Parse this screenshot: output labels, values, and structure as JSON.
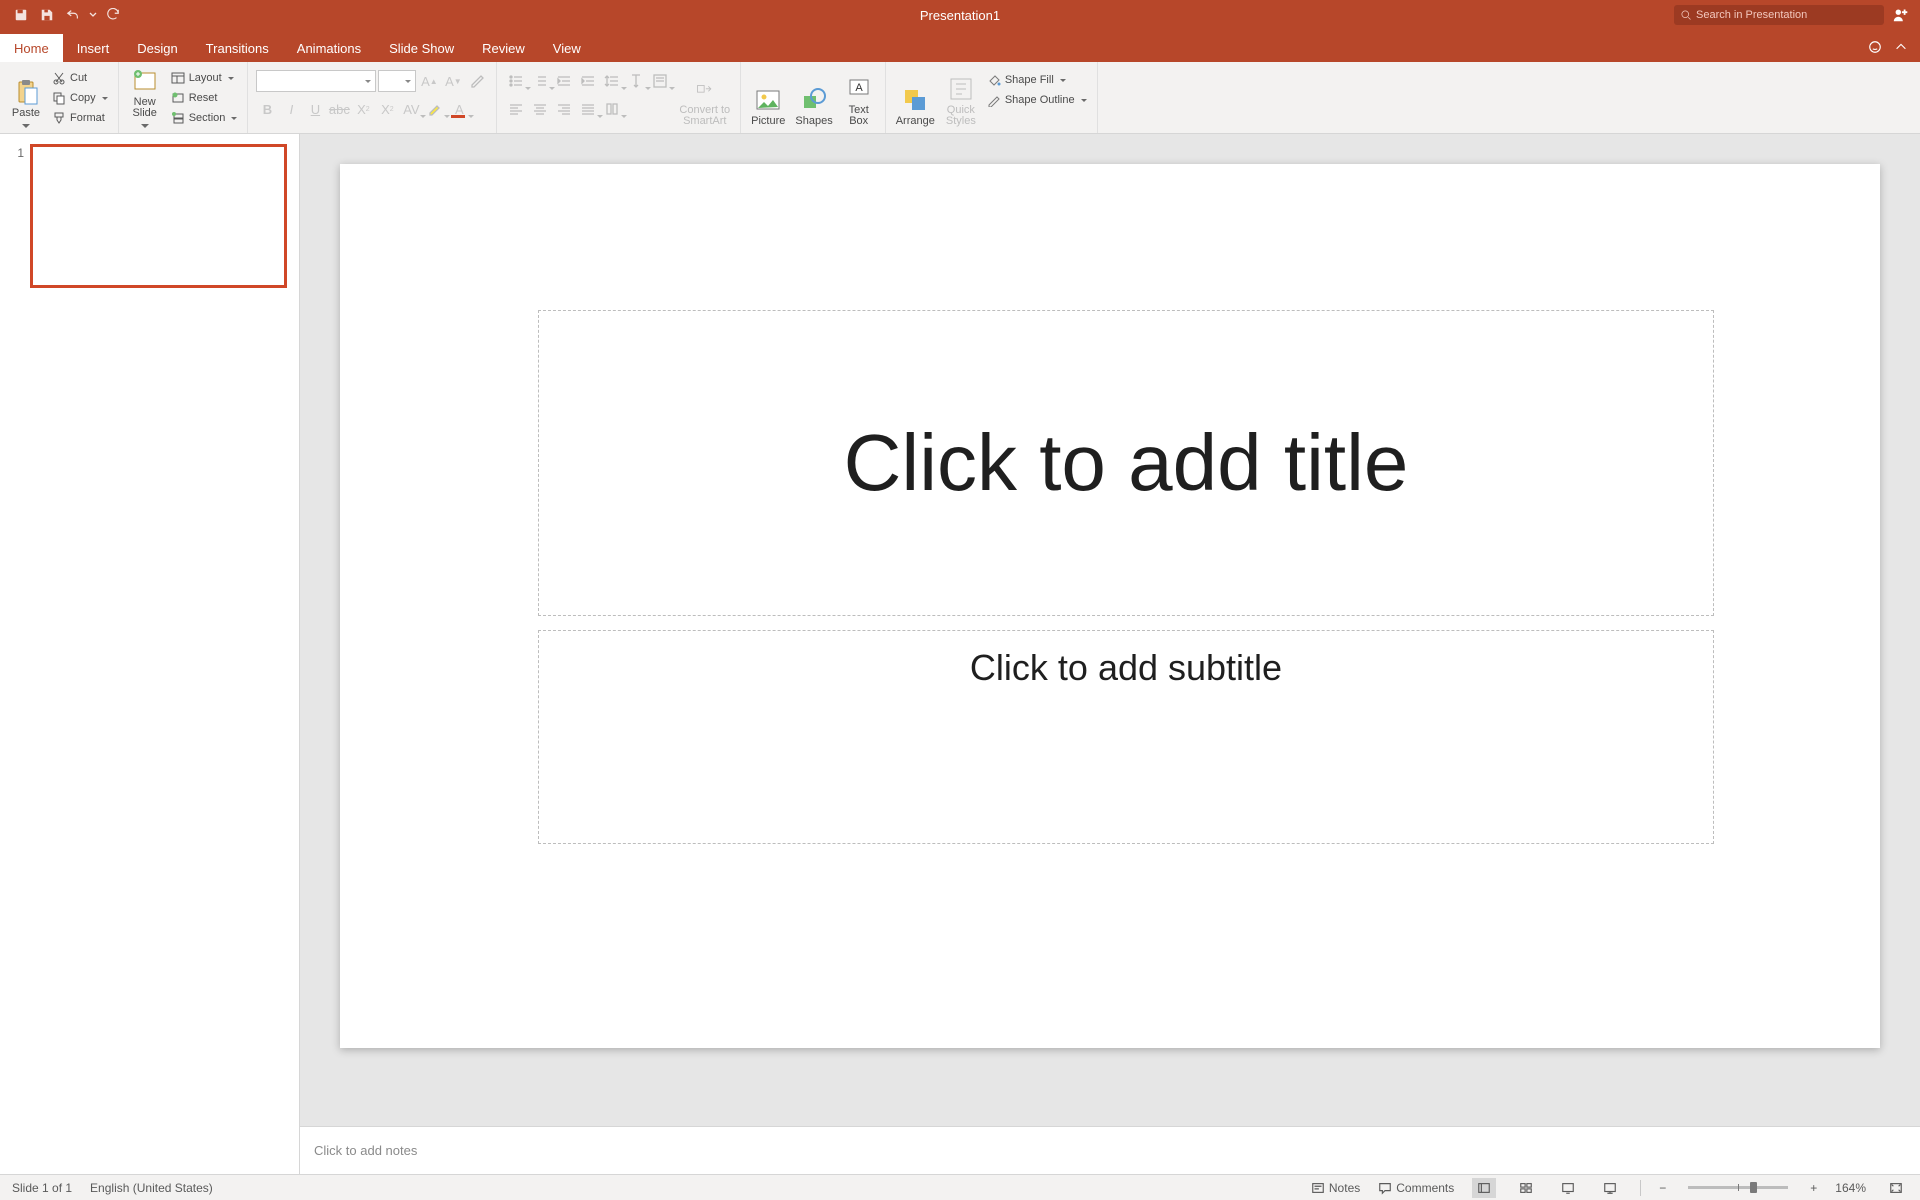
{
  "title": "Presentation1",
  "search_placeholder": "Search in Presentation",
  "tabs": [
    "Home",
    "Insert",
    "Design",
    "Transitions",
    "Animations",
    "Slide Show",
    "Review",
    "View"
  ],
  "ribbon": {
    "paste": "Paste",
    "cut": "Cut",
    "copy": "Copy",
    "format": "Format",
    "new_slide": "New\nSlide",
    "layout": "Layout",
    "reset": "Reset",
    "section": "Section",
    "convert": "Convert to\nSmartArt",
    "picture": "Picture",
    "shapes": "Shapes",
    "textbox": "Text\nBox",
    "arrange": "Arrange",
    "quick": "Quick\nStyles",
    "shape_fill": "Shape Fill",
    "shape_outline": "Shape Outline"
  },
  "thumb": {
    "num": "1"
  },
  "slide": {
    "title_ph": "Click to add title",
    "sub_ph": "Click to add subtitle"
  },
  "notes_placeholder": "Click to add notes",
  "status": {
    "slide": "Slide 1 of 1",
    "lang": "English (United States)",
    "notes": "Notes",
    "comments": "Comments",
    "zoom": "164%"
  }
}
